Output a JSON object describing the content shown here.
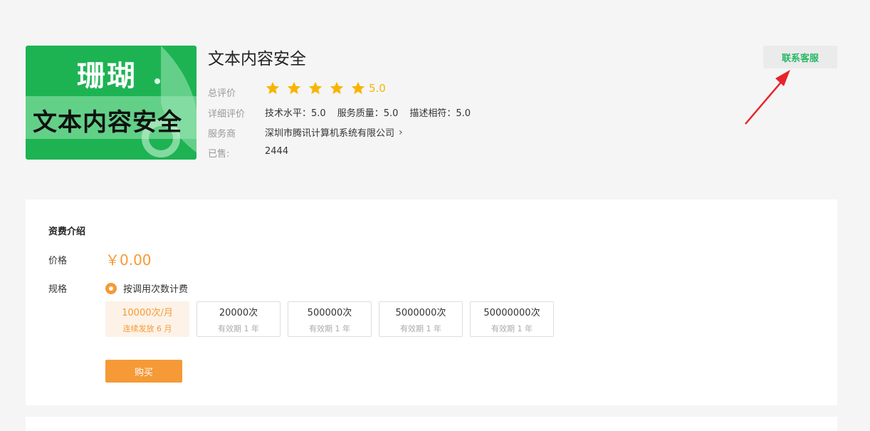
{
  "product": {
    "image_brand": "珊瑚",
    "image_text": "文本内容安全",
    "title": "文本内容安全",
    "overall_label": "总评价",
    "rating": "5.0",
    "rating_stars": 5,
    "detail_label": "详细评价",
    "detail_items": [
      "技术水平：5.0",
      "服务质量：5.0",
      "描述相符：5.0"
    ],
    "vendor_label": "服务商",
    "vendor_name": "深圳市腾讯计算机系统有限公司",
    "sold_label": "已售:",
    "sold_count": "2444"
  },
  "contact_button": "联系客服",
  "pricing": {
    "section_title": "资费介绍",
    "price_label": "价格",
    "price": "￥0.00",
    "spec_label": "规格",
    "billing_option": "按调用次数计费",
    "specs": [
      {
        "main": "10000次/月",
        "sub": "连续发放 6 月",
        "selected": true
      },
      {
        "main": "20000次",
        "sub": "有效期 1 年",
        "selected": false
      },
      {
        "main": "500000次",
        "sub": "有效期 1 年",
        "selected": false
      },
      {
        "main": "5000000次",
        "sub": "有效期 1 年",
        "selected": false
      },
      {
        "main": "50000000次",
        "sub": "有效期 1 年",
        "selected": false
      }
    ],
    "buy_button": "购买"
  },
  "colors": {
    "accent_orange": "#f59a37",
    "star": "#f7b500",
    "contact_green": "#26b865",
    "image_green": "#1db353",
    "arrow_red": "#e8232a"
  }
}
